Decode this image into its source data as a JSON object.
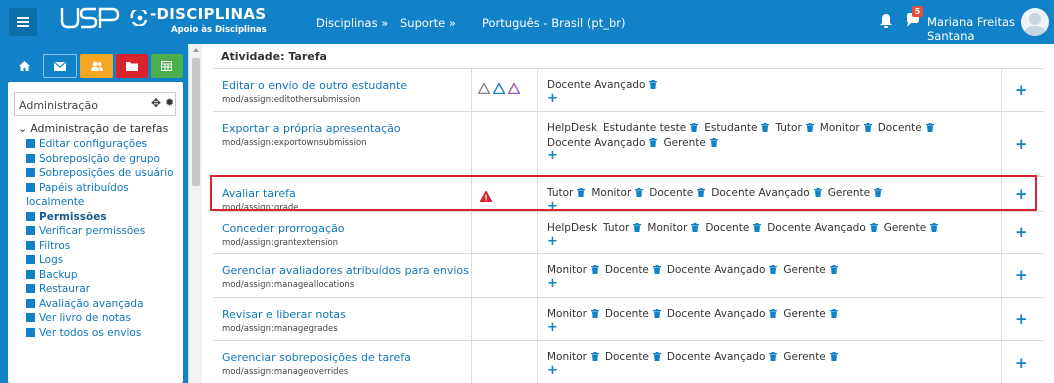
{
  "navbar": {
    "logo_text": "-DISCIPLINAS",
    "logo_sub": "Apoio às Disciplinas",
    "links": [
      "Disciplinas »",
      "Suporte »",
      "Português - Brasil (pt_br)"
    ],
    "notification_count": "5",
    "user_name": "Mariana Freitas Santana"
  },
  "sidebar": {
    "block_title": "Administração",
    "tree_title": "Administração de tarefas",
    "items": [
      "Editar configurações",
      "Sobreposição de grupo",
      "Sobreposições de usuário",
      "Papéis atribuídos localmente",
      "Permissões",
      "Verificar permissões",
      "Filtros",
      "Logs",
      "Backup",
      "Restaurar",
      "Avaliação avançada",
      "Ver livro de notas",
      "Ver todos os envios"
    ]
  },
  "main": {
    "section_title": "Atividade: Tarefa",
    "rows": [
      {
        "name": "Editar o envio de outro estudante",
        "id": "mod/assign:editothersubmission",
        "roles": [
          "Docente Avançado"
        ],
        "risks": [
          "triangle-gray",
          "triangle-blue",
          "triangle-purple"
        ]
      },
      {
        "name": "Exportar a própria apresentação",
        "id": "mod/assign:exportownsubmission",
        "roles": [
          "HelpDesk",
          "Estudante teste",
          "Estudante",
          "Tutor",
          "Monitor",
          "Docente",
          "Docente Avançado",
          "Gerente"
        ],
        "removable": [
          false,
          true,
          true,
          true,
          true,
          true,
          true,
          true
        ],
        "risks": []
      },
      {
        "name": "Avaliar tarefa",
        "id": "mod/assign:grade",
        "roles": [
          "Tutor",
          "Monitor",
          "Docente",
          "Docente Avançado",
          "Gerente"
        ],
        "risks": [
          "triangle-red"
        ]
      },
      {
        "name": "Conceder prorrogação",
        "id": "mod/assign:grantextension",
        "roles": [
          "HelpDesk",
          "Tutor",
          "Monitor",
          "Docente",
          "Docente Avançado",
          "Gerente"
        ],
        "removable": [
          false,
          true,
          true,
          true,
          true,
          true
        ],
        "risks": []
      },
      {
        "name": "Gerenciar avaliadores atribuídos para envios",
        "id": "mod/assign:manageallocations",
        "roles": [
          "Monitor",
          "Docente",
          "Docente Avançado",
          "Gerente"
        ],
        "risks": []
      },
      {
        "name": "Revisar e liberar notas",
        "id": "mod/assign:managegrades",
        "roles": [
          "Monitor",
          "Docente",
          "Docente Avançado",
          "Gerente"
        ],
        "risks": []
      },
      {
        "name": "Gerenciar sobreposições de tarefa",
        "id": "mod/assign:manageoverrides",
        "roles": [
          "Monitor",
          "Docente",
          "Docente Avançado",
          "Gerente"
        ],
        "risks": []
      }
    ]
  },
  "colors": {
    "brand": "#1182c8",
    "highlight": "#d9232d",
    "quick_buttons": [
      "#1182c8",
      "#1182c8",
      "#f5a623",
      "#d9232d",
      "#4cae4c"
    ]
  }
}
